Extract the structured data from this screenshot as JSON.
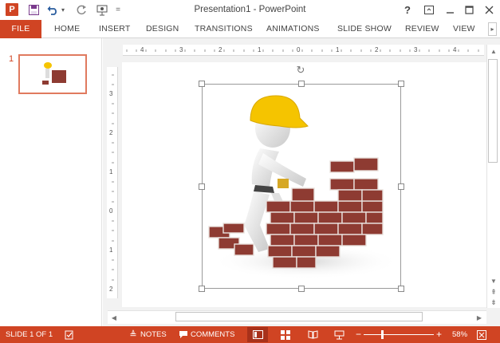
{
  "titlebar": {
    "app_logo_letter": "P",
    "title": "Presentation1 - PowerPoint",
    "help_label": "?",
    "icons": [
      "powerpoint-logo",
      "save-icon",
      "undo-icon",
      "redo-icon",
      "start-from-beginning-icon",
      "customize-qat-icon",
      "help-icon",
      "ribbon-display-options-icon",
      "minimize-icon",
      "restore-icon",
      "close-icon"
    ]
  },
  "ribbon": {
    "tabs": [
      {
        "label": "FILE"
      },
      {
        "label": "HOME"
      },
      {
        "label": "INSERT"
      },
      {
        "label": "DESIGN"
      },
      {
        "label": "TRANSITIONS"
      },
      {
        "label": "ANIMATIONS"
      },
      {
        "label": "SLIDE SHOW"
      },
      {
        "label": "REVIEW"
      },
      {
        "label": "VIEW"
      }
    ]
  },
  "thumbnails": {
    "slide_number": "1"
  },
  "rulers": {
    "horizontal": [
      "4",
      "3",
      "2",
      "1",
      "0",
      "1",
      "2",
      "3",
      "4"
    ],
    "vertical": [
      "3",
      "2",
      "1",
      "0",
      "1",
      "2"
    ]
  },
  "slide": {
    "image_description_icon": "construction-worker-building-brick-wall"
  },
  "statusbar": {
    "slide_info": "SLIDE 1 OF 1",
    "notes_label": "NOTES",
    "comments_label": "COMMENTS",
    "zoom_minus": "−",
    "zoom_plus": "+",
    "zoom_level": "58%",
    "zoom_fraction": 0.58
  },
  "colors": {
    "accent": "#d04423",
    "accent_dark": "#a8311a",
    "hat": "#f5c400",
    "brick": "#8e3b32"
  }
}
